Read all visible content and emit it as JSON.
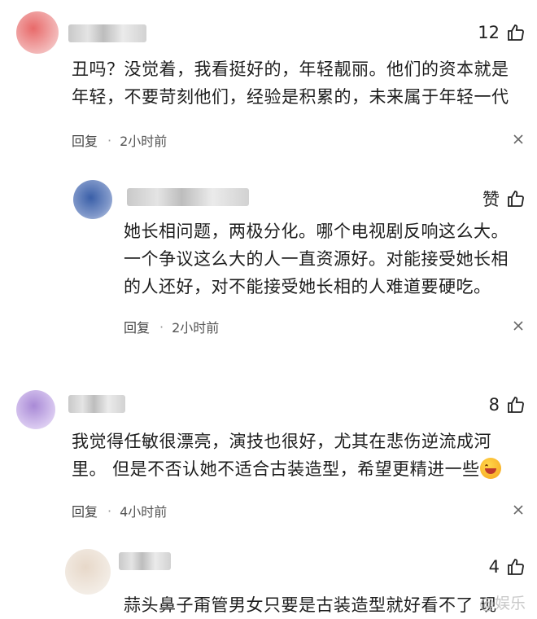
{
  "comments": [
    {
      "likes": "12",
      "lines": [
        "丑吗？没觉着，我看挺好的，年轻靓丽。他们的资本就是",
        "年轻，不要苛刻他们，经验是积累的，未来属于年轻一代"
      ],
      "reply_label": "回复",
      "time": "2小时前"
    },
    {
      "likes": "赞",
      "lines": [
        "她长相问题，两极分化。哪个电视剧反响这么大。",
        "一个争议这么大的人一直资源好。对能接受她长相",
        "的人还好，对不能接受她长相的人难道要硬吃。"
      ],
      "reply_label": "回复",
      "time": "2小时前"
    },
    {
      "likes": "8",
      "lines": [
        "我觉得任敏很漂亮，演技也很好，尤其在悲伤逆流成河",
        "里。 但是不否认她不适合古装造型，希望更精进一些"
      ],
      "reply_label": "回复",
      "time": "4小时前"
    },
    {
      "likes": "4",
      "lines": [
        "蒜头鼻子甭管男女只要是古装造型就好看不了 现"
      ]
    }
  ],
  "watermark": "@娱乐"
}
